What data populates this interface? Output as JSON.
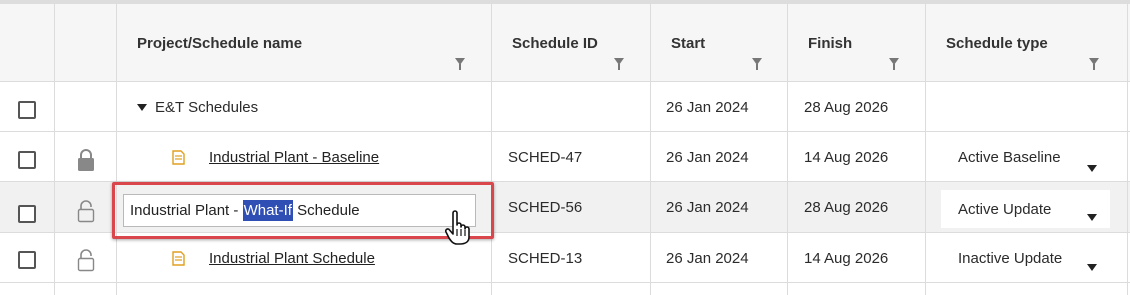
{
  "columns": {
    "name": "Project/Schedule name",
    "schedule_id": "Schedule ID",
    "start": "Start",
    "finish": "Finish",
    "schedule_type": "Schedule type"
  },
  "group": {
    "label": "E&T Schedules",
    "start": "26 Jan 2024",
    "finish": "28 Aug 2026"
  },
  "rows": [
    {
      "name": "Industrial Plant - Baseline",
      "schedule_id": "SCHED-47",
      "start": "26 Jan 2024",
      "finish": "14 Aug 2026",
      "schedule_type": "Active Baseline",
      "lock": "lock-closed-icon"
    },
    {
      "name_prefix": "Industrial Plant - ",
      "name_selected": "What-If",
      "name_suffix": " Schedule",
      "schedule_id": "SCHED-56",
      "start": "26 Jan 2024",
      "finish": "28 Aug 2026",
      "schedule_type": "Active Update",
      "lock": "lock-open-icon"
    },
    {
      "name": "Industrial Plant Schedule",
      "schedule_id": "SCHED-13",
      "start": "26 Jan 2024",
      "finish": "14 Aug 2026",
      "schedule_type": "Inactive Update",
      "lock": "lock-open-icon"
    }
  ],
  "colors": {
    "highlight_border": "#d9474c",
    "selection": "#2f4fb5",
    "doc_icon": "#e0a020"
  }
}
